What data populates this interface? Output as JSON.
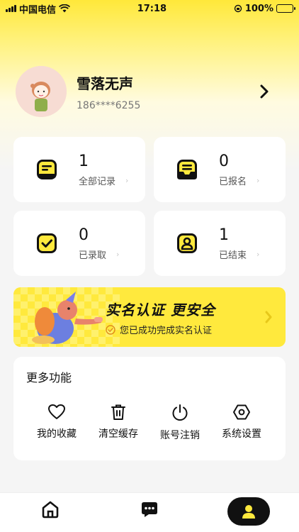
{
  "status_bar": {
    "carrier": "中国电信",
    "time": "17:18",
    "battery": "100%"
  },
  "profile": {
    "name": "雪落无声",
    "phone": "186****6255"
  },
  "stats": [
    {
      "count": "1",
      "label": "全部记录"
    },
    {
      "count": "0",
      "label": "已报名"
    },
    {
      "count": "0",
      "label": "已录取"
    },
    {
      "count": "1",
      "label": "已结束"
    }
  ],
  "banner": {
    "title": "实名认证  更安全",
    "subtitle": "您已成功完成实名认证"
  },
  "more": {
    "title": "更多功能",
    "items": [
      {
        "label": "我的收藏",
        "icon": "heart-icon"
      },
      {
        "label": "清空缓存",
        "icon": "trash-icon"
      },
      {
        "label": "账号注销",
        "icon": "power-icon"
      },
      {
        "label": "系统设置",
        "icon": "settings-icon"
      }
    ]
  },
  "tabbar": {
    "items": [
      "home-icon",
      "message-icon",
      "user-icon"
    ],
    "active": "user-icon"
  },
  "colors": {
    "accent": "#FFE93D",
    "dark": "#111111"
  }
}
